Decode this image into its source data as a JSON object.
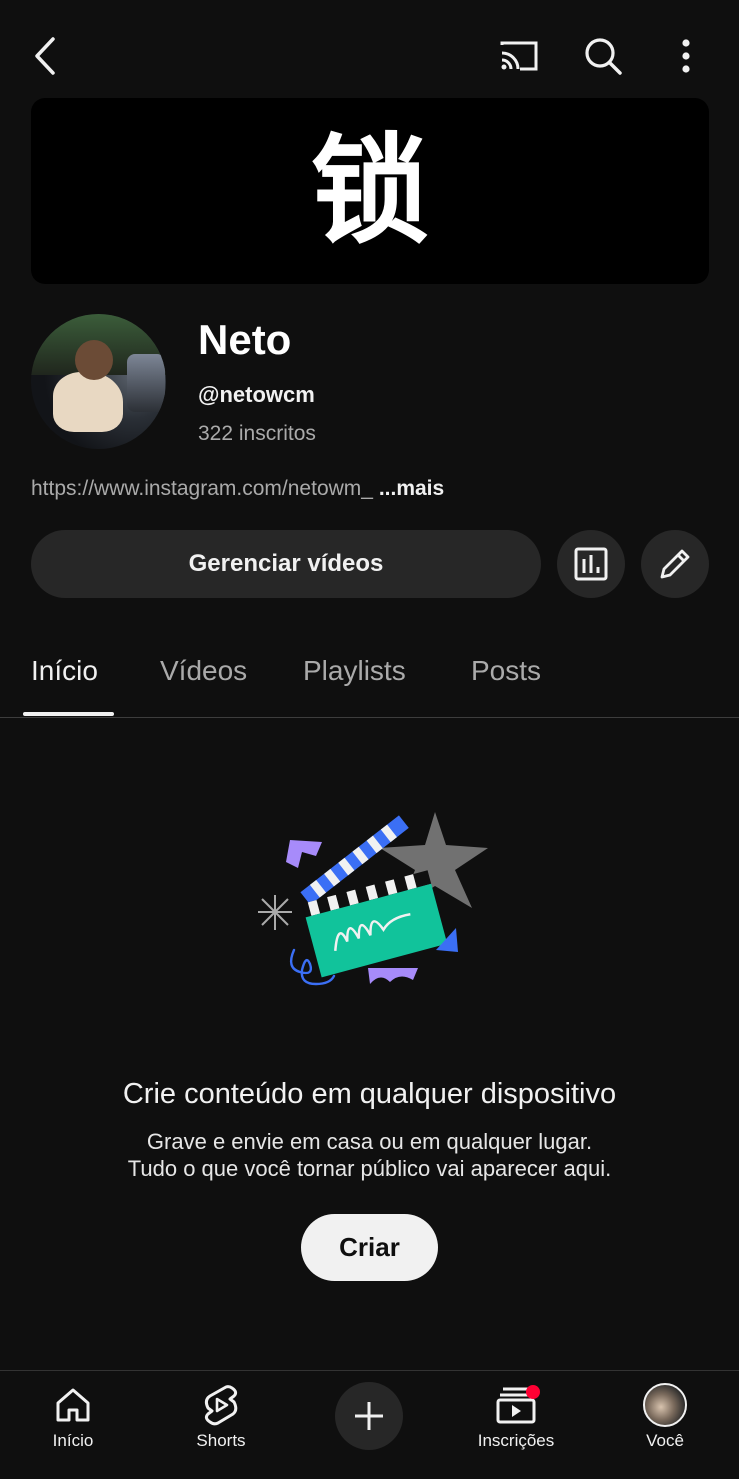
{
  "header": {
    "back_icon": "chevron-left-icon",
    "cast_icon": "cast-icon",
    "search_icon": "search-icon",
    "more_icon": "more-vert-icon"
  },
  "banner": {
    "text": "锁"
  },
  "channel": {
    "name": "Neto",
    "handle": "@netowcm",
    "subscribers": "322 inscritos",
    "link": "https://www.instagram.com/netowm_",
    "more_label": "...mais"
  },
  "actions": {
    "manage_label": "Gerenciar vídeos",
    "analytics_icon": "analytics-icon",
    "edit_icon": "edit-pencil-icon"
  },
  "tabs": [
    {
      "label": "Início",
      "selected": true
    },
    {
      "label": "Vídeos",
      "selected": false
    },
    {
      "label": "Playlists",
      "selected": false
    },
    {
      "label": "Posts",
      "selected": false
    }
  ],
  "empty_state": {
    "title": "Crie conteúdo em qualquer dispositivo",
    "line1": "Grave e envie em casa ou em qualquer lugar.",
    "line2": "Tudo o que você tornar público vai aparecer aqui.",
    "button": "Criar"
  },
  "bottom_nav": {
    "home": "Início",
    "shorts": "Shorts",
    "subscriptions": "Inscrições",
    "you": "Você",
    "create_icon": "plus-icon"
  },
  "colors": {
    "background": "#0f0f0f",
    "surface": "#272727",
    "text_primary": "#f1f1f1",
    "text_secondary": "#aaaaaa",
    "notification": "#ff0033"
  }
}
